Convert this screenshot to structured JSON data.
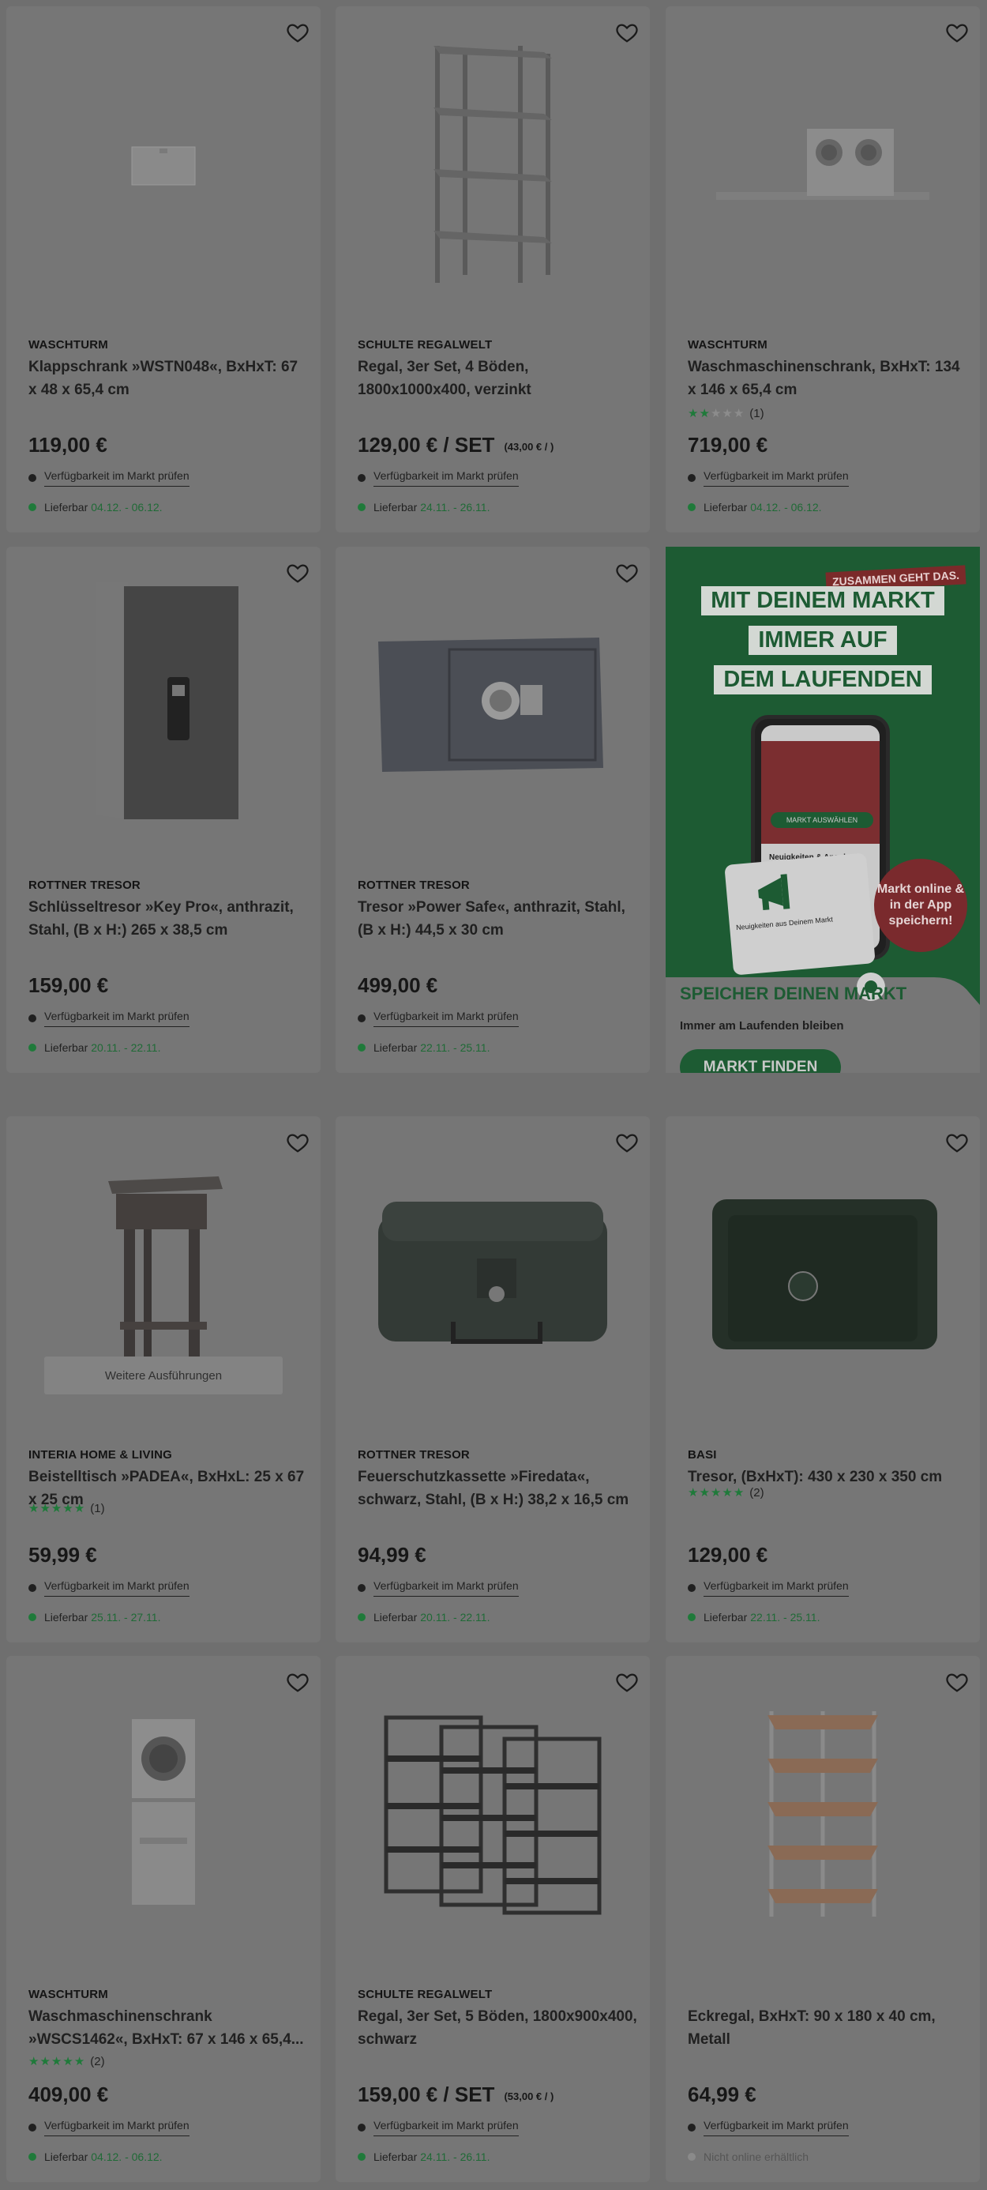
{
  "colors": {
    "background": "#6f6f6f",
    "card": "#767676",
    "accent_green": "#1d5b33",
    "delivery_green": "#1f7a3a"
  },
  "common": {
    "availability_label": "Verfügbarkeit im Markt prüfen",
    "delivery_label": "Lieferbar",
    "favorite_icon": "heart-outline-icon"
  },
  "products": [
    {
      "brand": "WASCHTURM",
      "title": "Klappschrank »WSTN048«, BxHxT: 67 x 48 x 65,4 cm",
      "price": "119,00 €",
      "unit_price": "",
      "rating": null,
      "rating_count": "",
      "delivery": "04.12. - 06.12.",
      "image": "wall-cabinet"
    },
    {
      "brand": "SCHULTE REGALWELT",
      "title": "Regal, 3er Set, 4 Böden, 1800x1000x400, verzinkt",
      "price": "129,00 € / SET",
      "unit_price": "(43,00 € / )",
      "rating": null,
      "rating_count": "",
      "delivery": "24.11. - 26.11.",
      "image": "metal-shelf"
    },
    {
      "brand": "WASCHTURM",
      "title": "Waschmaschinenschrank, BxHxT: 134 x 146 x 65,4 cm",
      "price": "719,00 €",
      "unit_price": "",
      "rating": 2,
      "rating_count": "(1)",
      "delivery": "04.12. - 06.12.",
      "image": "washer-cabinet"
    },
    {
      "brand": "ROTTNER TRESOR",
      "title": "Schlüsseltresor »Key Pro«, anthrazit, Stahl, (B x H:) 265 x 38,5 cm",
      "price": "159,00 €",
      "unit_price": "",
      "rating": null,
      "rating_count": "",
      "delivery": "20.11. - 22.11.",
      "image": "key-safe"
    },
    {
      "brand": "ROTTNER TRESOR",
      "title": "Tresor »Power Safe«, anthrazit, Stahl, (B x H:) 44,5 x 30 cm",
      "price": "499,00 €",
      "unit_price": "",
      "rating": null,
      "rating_count": "",
      "delivery": "22.11. - 25.11.",
      "image": "power-safe"
    },
    {
      "brand": "INTERIA HOME & LIVING",
      "title": "Beistelltisch »PADEA«, BxHxL: 25 x 67 x 25 cm",
      "price": "59,99 €",
      "unit_price": "",
      "rating": 5,
      "rating_count": "(1)",
      "delivery": "25.11. - 27.11.",
      "image": "side-table",
      "variants_label": "Weitere Ausführungen"
    },
    {
      "brand": "ROTTNER TRESOR",
      "title": "Feuerschutzkassette »Firedata«, schwarz, Stahl, (B x H:) 38,2 x 16,5 cm",
      "price": "94,99 €",
      "unit_price": "",
      "rating": null,
      "rating_count": "",
      "delivery": "20.11. - 22.11.",
      "image": "fire-box"
    },
    {
      "brand": "BASI",
      "title": "Tresor, (BxHxT): 430 x 230 x 350 cm",
      "price": "129,00 €",
      "unit_price": "",
      "rating": 5,
      "rating_count": "(2)",
      "delivery": "22.11. - 25.11.",
      "image": "basi-safe"
    },
    {
      "brand": "WASCHTURM",
      "title": "Waschmaschinenschrank »WSCS1462«, BxHxT: 67 x 146 x 65,4...",
      "price": "409,00 €",
      "unit_price": "",
      "rating": 5,
      "rating_count": "(2)",
      "delivery": "04.12. - 06.12.",
      "image": "washer-tower"
    },
    {
      "brand": "SCHULTE REGALWELT",
      "title": "Regal, 3er Set, 5 Böden, 1800x900x400, schwarz",
      "price": "159,00 € / SET",
      "unit_price": "(53,00 € / )",
      "rating": null,
      "rating_count": "",
      "delivery": "24.11. - 26.11.",
      "image": "black-shelves"
    },
    {
      "brand": "",
      "title": "Eckregal, BxHxT: 90 x 180 x 40 cm, Metall",
      "price": "64,99 €",
      "unit_price": "",
      "rating": null,
      "rating_count": "",
      "delivery": "",
      "not_available": "Nicht online erhältlich",
      "image": "corner-shelf"
    }
  ],
  "promo": {
    "tagline": "ZUSAMMEN GEHT DAS.",
    "headline1": "MIT DEINEM MARKT",
    "headline2": "IMMER AUF",
    "headline3": "DEM LAUFENDEN",
    "phone_button": "MARKT AUSWÄHLEN",
    "phone_text": "Neuigkeiten & Angebote",
    "card_text": "Neuigkeiten aus Deinem Markt",
    "badge": "Markt online & in der App speichern!",
    "title": "SPEICHER DEINEN MARKT",
    "subtitle": "Immer am Laufenden bleiben",
    "button": "MARKT FINDEN"
  }
}
